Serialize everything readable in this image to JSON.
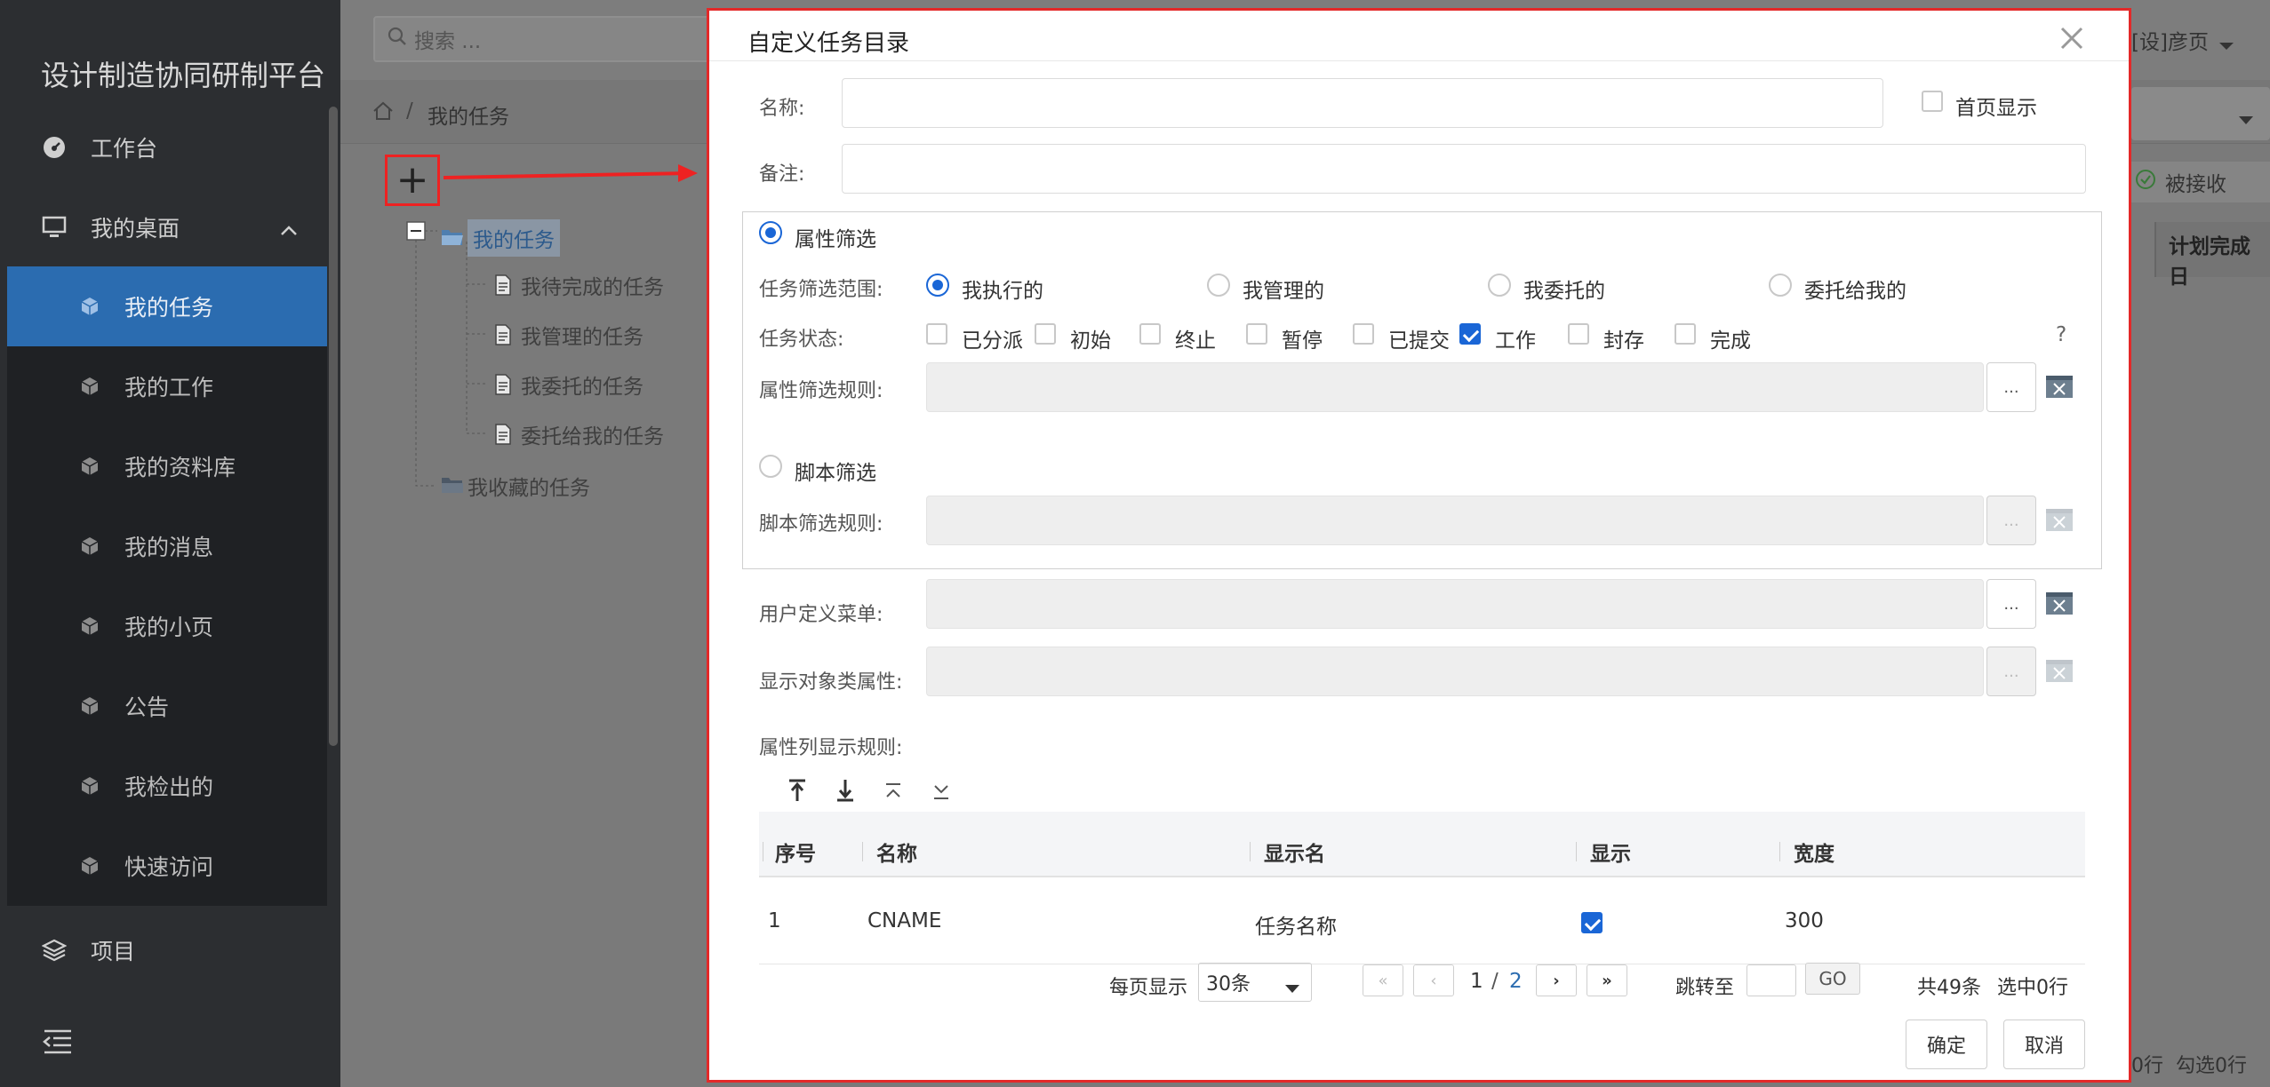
{
  "app": {
    "title": "设计制造协同研制平台"
  },
  "sidebar": {
    "workbench": "工作台",
    "desktop": "我的桌面",
    "items": [
      "我的任务",
      "我的工作",
      "我的资料库",
      "我的消息",
      "我的小页",
      "公告",
      "我检出的",
      "快速访问"
    ],
    "project": "项目"
  },
  "topbar": {
    "search_placeholder": "搜索 ...",
    "user": "[设]彦页"
  },
  "breadcrumb": {
    "current": "我的任务"
  },
  "tree": {
    "root": "我的任务",
    "children": [
      "我待完成的任务",
      "我管理的任务",
      "我委托的任务",
      "委托给我的任务"
    ],
    "favorites": "我收藏的任务"
  },
  "background": {
    "received": "被接收",
    "planned_finish": "计划完成日",
    "footer": "0行  勾选0行"
  },
  "dialog": {
    "title": "自定义任务目录",
    "name_label": "名称:",
    "home_display": "首页显示",
    "remark_label": "备注:",
    "attr_filter": "属性筛选",
    "scope_label": "任务筛选范围:",
    "scopes": [
      "我执行的",
      "我管理的",
      "我委托的",
      "委托给我的"
    ],
    "status_label": "任务状态:",
    "statuses": [
      {
        "label": "已分派",
        "checked": false
      },
      {
        "label": "初始",
        "checked": false
      },
      {
        "label": "终止",
        "checked": false
      },
      {
        "label": "暂停",
        "checked": false
      },
      {
        "label": "已提交",
        "checked": false
      },
      {
        "label": "工作",
        "checked": true
      },
      {
        "label": "封存",
        "checked": false
      },
      {
        "label": "完成",
        "checked": false
      }
    ],
    "help": "?",
    "attr_rule_label": "属性筛选规则:",
    "script_filter": "脚本筛选",
    "script_rule_label": "脚本筛选规则:",
    "user_menu_label": "用户定义菜单:",
    "display_attr_label": "显示对象类属性:",
    "column_rule_label": "属性列显示规则:",
    "dots": "...",
    "table": {
      "headers": [
        "序号",
        "名称",
        "显示名",
        "显示",
        "宽度"
      ],
      "rows": [
        {
          "index": "1",
          "name": "CNAME",
          "display_name": "任务名称",
          "show": true,
          "width": "300"
        }
      ]
    },
    "pager": {
      "per_page_label": "每页显示",
      "per_page": "30条",
      "current": "1",
      "slash": "/",
      "total_pages": "2",
      "jump_label": "跳转至",
      "go": "GO",
      "total": "共49条",
      "selected": "选中0行"
    },
    "ok": "确定",
    "cancel": "取消"
  },
  "colors": {
    "accent": "#1a66d6",
    "highlight_border": "#e32929",
    "sidebar_active": "#2b6cb0"
  }
}
